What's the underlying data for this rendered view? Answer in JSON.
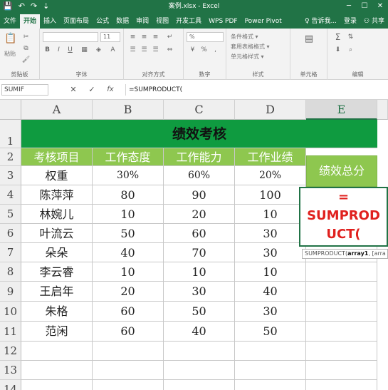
{
  "window": {
    "title": "案例.xlsx - Excel",
    "qa_save": "💾",
    "qa_undo": "↶",
    "qa_redo": "↷",
    "qa_more": "⇣",
    "minimize": "─",
    "maximize": "☐",
    "close": "✕"
  },
  "tabs": [
    "文件",
    "开始",
    "插入",
    "页面布局",
    "公式",
    "数据",
    "审阅",
    "视图",
    "开发工具",
    "WPS PDF",
    "Power Pivot"
  ],
  "active_tab": "开始",
  "tab_right": {
    "tell_me": "告诉我...",
    "login": "登录",
    "share": "共享"
  },
  "ribbon": {
    "groups": {
      "clipboard": "剪贴板",
      "font": "字体",
      "alignment": "对齐方式",
      "number": "数字",
      "styles": "样式",
      "cells": "单元格",
      "editing": "编辑"
    },
    "paste_label": "粘贴",
    "font_size": "11",
    "font_name": "",
    "number_format": "%",
    "style_items": [
      "条件格式 ▾",
      "套用表格格式 ▾",
      "单元格样式 ▾"
    ],
    "bold": "B",
    "italic": "I",
    "underline": "U"
  },
  "formula_bar": {
    "name_box": "SUMIF",
    "cancel": "✕",
    "enter": "✓",
    "fx": "fx",
    "content": "=SUMPRODUCT("
  },
  "columns": [
    "A",
    "B",
    "C",
    "D",
    "E"
  ],
  "rows": [
    "1",
    "2",
    "3",
    "4",
    "5",
    "6",
    "7",
    "8",
    "9",
    "10",
    "11",
    "12",
    "13",
    "14"
  ],
  "sheet": {
    "title": "绩效考核",
    "headers": [
      "考核项目",
      "工作态度",
      "工作能力",
      "工作业绩"
    ],
    "e_header": "绩效总分",
    "weights": [
      "权重",
      "30%",
      "60%",
      "20%"
    ],
    "data": [
      [
        "陈萍萍",
        "80",
        "90",
        "100"
      ],
      [
        "林婉儿",
        "10",
        "20",
        "10"
      ],
      [
        "叶流云",
        "50",
        "60",
        "30"
      ],
      [
        "朵朵",
        "40",
        "70",
        "30"
      ],
      [
        "李云睿",
        "10",
        "10",
        "10"
      ],
      [
        "王启年",
        "20",
        "30",
        "40"
      ],
      [
        "朱格",
        "60",
        "50",
        "30"
      ],
      [
        "范闲",
        "60",
        "40",
        "50"
      ]
    ],
    "editing_text": "=\nSUMPROD\nUCT(",
    "tooltip": {
      "fn": "SUMPRODUCT(",
      "arg1": "array1",
      "rest": ", [arra"
    }
  },
  "colors": {
    "excel_green": "#217346",
    "title_fill": "#0f9b40",
    "header_fill": "#8ec74f",
    "edit_red": "#e0201e"
  }
}
